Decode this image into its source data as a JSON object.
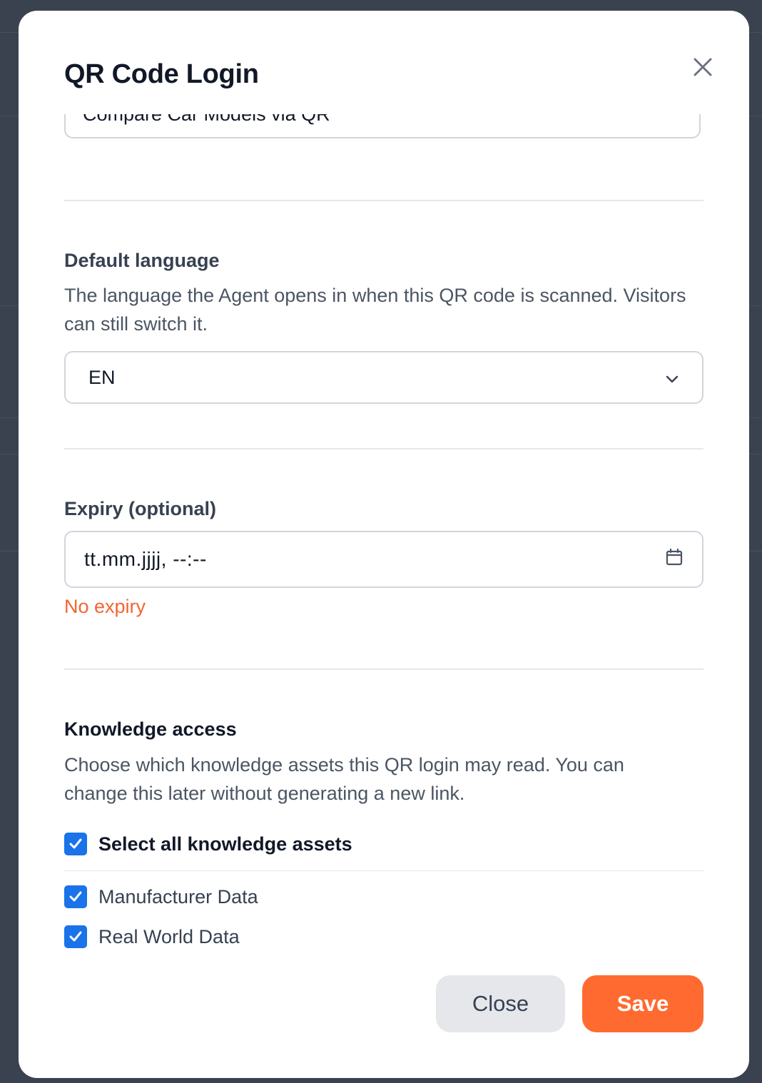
{
  "modal": {
    "title": "QR Code Login",
    "name_value": "Compare Car Models via QR"
  },
  "language": {
    "label": "Default language",
    "help": "The language the Agent opens in when this QR code is scanned. Visitors can still switch it.",
    "selected": "EN"
  },
  "expiry": {
    "label": "Expiry (optional)",
    "placeholder": "tt.mm.jjjj, --:--",
    "note": "No expiry"
  },
  "knowledge": {
    "label": "Knowledge access",
    "help": "Choose which knowledge assets this QR login may read. You can change this later without generating a new link.",
    "select_all_label": "Select all knowledge assets",
    "select_all_checked": true,
    "assets": [
      {
        "label": "Manufacturer Data",
        "checked": true
      },
      {
        "label": "Real World Data",
        "checked": true
      }
    ]
  },
  "footer": {
    "close_label": "Close",
    "save_label": "Save"
  },
  "colors": {
    "accent": "#ff6a30",
    "checkbox": "#1a73e8",
    "note": "#f26531"
  },
  "icons": {
    "close": "close-icon",
    "dropdown": "chevron-down-icon",
    "calendar": "calendar-icon",
    "check": "checkmark-icon"
  }
}
